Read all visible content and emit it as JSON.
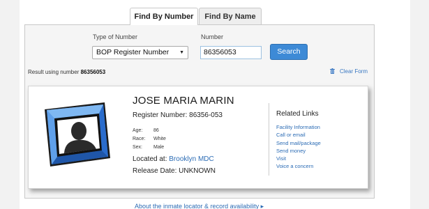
{
  "tabs": [
    {
      "label": "Find By Number",
      "active": true
    },
    {
      "label": "Find By Name",
      "active": false
    }
  ],
  "search": {
    "type_label": "Type of Number",
    "type_selected": "BOP Register Number",
    "number_label": "Number",
    "number_value": "86356053",
    "search_button": "Search"
  },
  "result": {
    "prefix": "Result using number",
    "number": "86356053",
    "clear_label": "Clear Form"
  },
  "inmate": {
    "name": "JOSE MARIA MARIN",
    "register_label": "Register Number:",
    "register_number": "86356-053",
    "age_label": "Age:",
    "age": "86",
    "race_label": "Race:",
    "race": "White",
    "sex_label": "Sex:",
    "sex": "Male",
    "located_label": "Located at:",
    "located": "Brooklyn MDC",
    "release_label": "Release Date:",
    "release": "UNKNOWN"
  },
  "related": {
    "title": "Related Links",
    "links": [
      "Facility Information",
      "Call or email",
      "Send mail/package",
      "Send money",
      "Visit",
      "Voice a concern"
    ]
  },
  "footer": {
    "link": "About the inmate locator & record availability ▸"
  },
  "colors": {
    "accent": "#3d8ad6",
    "link": "#2c6cb5",
    "avatar_frame": "#2f6fd0"
  }
}
